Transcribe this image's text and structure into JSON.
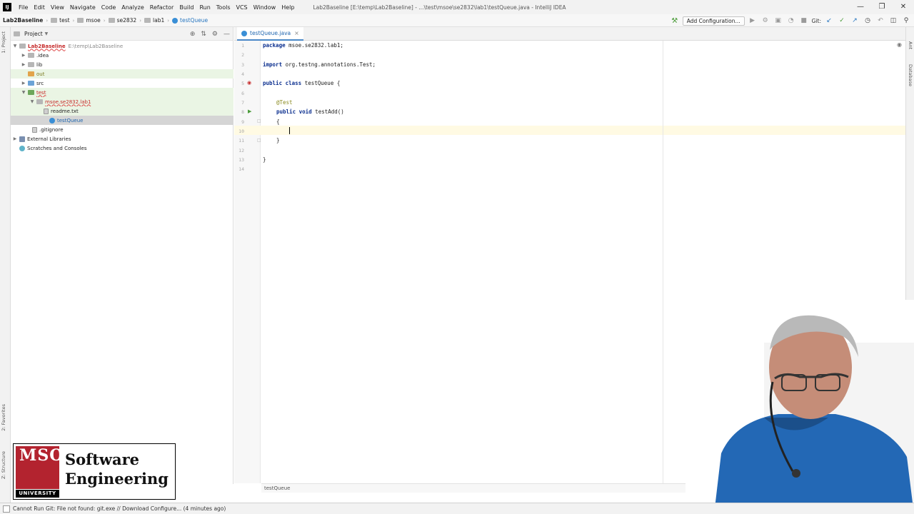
{
  "titlebar": {
    "menu": [
      "File",
      "Edit",
      "View",
      "Navigate",
      "Code",
      "Analyze",
      "Refactor",
      "Build",
      "Run",
      "Tools",
      "VCS",
      "Window",
      "Help"
    ],
    "window_title": "Lab2Baseline [E:\\temp\\Lab2Baseline] - ...\\test\\msoe\\se2832\\lab1\\testQueue.java - IntelliJ IDEA"
  },
  "navbar": {
    "crumbs": [
      "Lab2Baseline",
      "test",
      "msoe",
      "se2832",
      "lab1",
      "testQueue"
    ],
    "add_configuration": "Add Configuration...",
    "git_label": "Git:"
  },
  "left_stripe": {
    "project": "1: Project",
    "favorites": "2: Favorites",
    "structure": "Z: Structure"
  },
  "right_stripe": {
    "ant": "Ant",
    "database": "Database"
  },
  "project_panel": {
    "title": "Project",
    "tree": [
      {
        "label": "Lab2Baseline",
        "extra": "E:\\temp\\Lab2Baseline"
      },
      {
        "label": ".idea"
      },
      {
        "label": "lib"
      },
      {
        "label": "out"
      },
      {
        "label": "src"
      },
      {
        "label": "test"
      },
      {
        "label": "msoe.se2832.lab1"
      },
      {
        "label": "readme.txt"
      },
      {
        "label": "testQueue"
      },
      {
        "label": ".gitignore"
      },
      {
        "label": "External Libraries"
      },
      {
        "label": "Scratches and Consoles"
      }
    ]
  },
  "editor": {
    "tab": "testQueue.java",
    "line_numbers": [
      "1",
      "2",
      "3",
      "4",
      "5",
      "6",
      "7",
      "8",
      "9",
      "10",
      "11",
      "12",
      "13",
      "14"
    ],
    "code": {
      "l1_kw": "package",
      "l1_rest": " msoe.se2832.lab1;",
      "l3_kw": "import",
      "l3_rest": " org.testng.annotations.Test;",
      "l5_kw": "public class",
      "l5_rest": " testQueue {",
      "l7_ann": "@Test",
      "l8_kw": "public void",
      "l8_rest": " testAdd()",
      "l9": "{",
      "l11": "}",
      "l13": "}"
    },
    "breadcrumb": "testQueue"
  },
  "logo": {
    "mark": "MSOE",
    "university": "UNIVERSITY",
    "line1": "Software",
    "line2": "Engineering"
  },
  "statusbar": {
    "message": "Cannot Run Git: File not found: git.exe // Download   Configure... (4 minutes ago)"
  }
}
